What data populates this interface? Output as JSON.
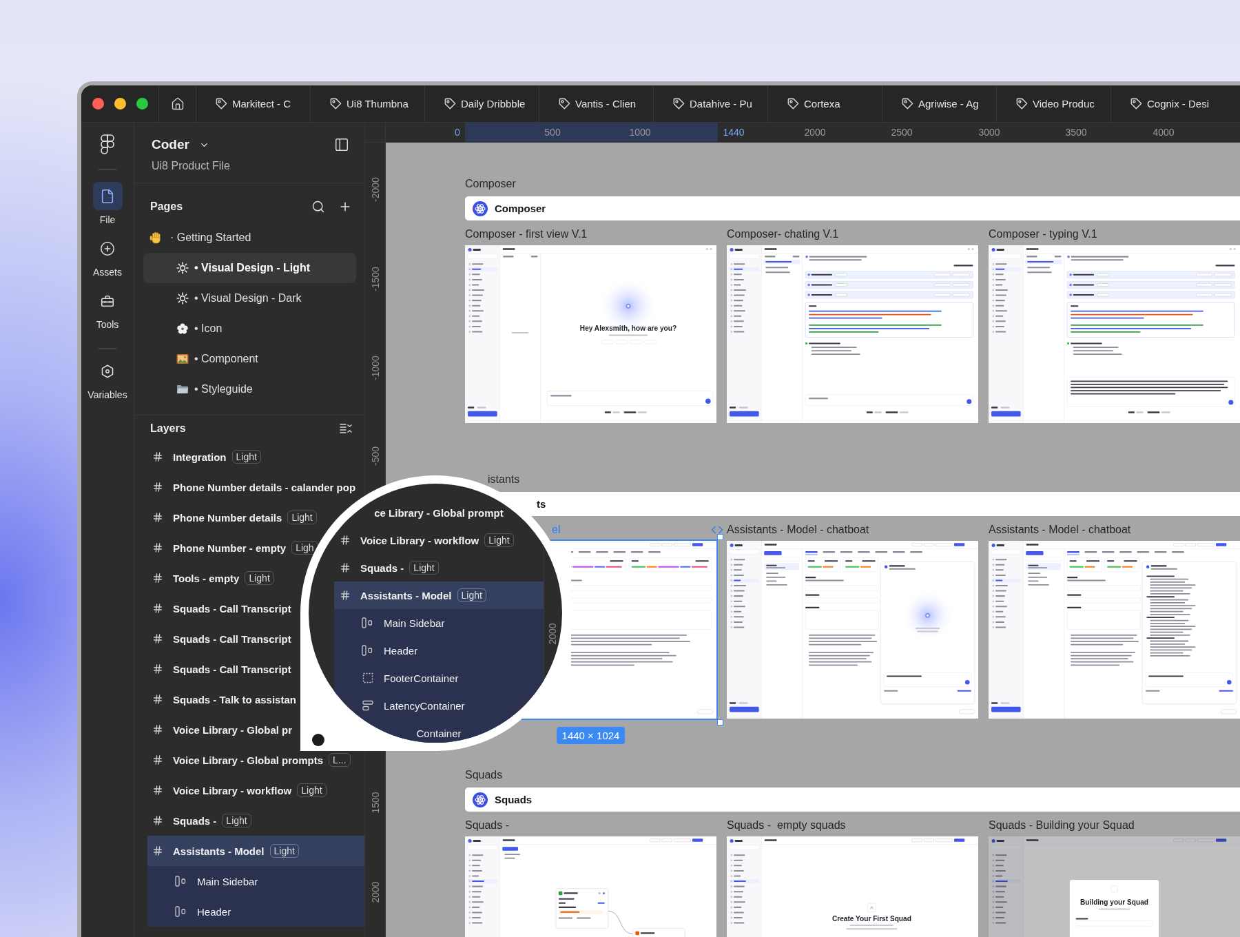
{
  "window": {
    "tabs": [
      {
        "label": "Markitect - C",
        "selected": false
      },
      {
        "label": "Ui8 Thumbna",
        "selected": false
      },
      {
        "label": "Daily Dribbble",
        "selected": false
      },
      {
        "label": "Vantis - Clien",
        "selected": false
      },
      {
        "label": "Datahive - Pu",
        "selected": false
      },
      {
        "label": "Cortexa",
        "selected": false
      },
      {
        "label": "Agriwise - Ag",
        "selected": false
      },
      {
        "label": "Video Produc",
        "selected": false
      },
      {
        "label": "Cognix - Desi",
        "selected": false
      }
    ]
  },
  "rail": {
    "items": [
      {
        "label": "File",
        "selected": true
      },
      {
        "label": "Assets",
        "selected": false
      },
      {
        "label": "Tools",
        "selected": false
      },
      {
        "label": "Variables",
        "selected": false
      }
    ]
  },
  "file": {
    "name": "Coder",
    "subtitle": "Ui8 Product File"
  },
  "pages": {
    "title": "Pages",
    "items": [
      {
        "kind": "heading",
        "label": "· Getting Started",
        "selected": false
      },
      {
        "kind": "page",
        "label": "• Visual Design - Light",
        "selected": true
      },
      {
        "kind": "page",
        "label": "• Visual Design - Dark",
        "selected": false
      },
      {
        "kind": "page",
        "label": "• Icon",
        "selected": false
      },
      {
        "kind": "page",
        "label": "• Component",
        "selected": false
      },
      {
        "kind": "page",
        "label": "• Styleguide",
        "selected": false
      }
    ]
  },
  "layers": {
    "title": "Layers",
    "items": [
      {
        "kind": "frame",
        "label": "Integration",
        "badge": "Light",
        "selected": false
      },
      {
        "kind": "frame",
        "label": "Phone Number details - calander pop",
        "selected": false
      },
      {
        "kind": "frame",
        "label": "Phone Number details",
        "badge": "Light",
        "selected": false
      },
      {
        "kind": "frame",
        "label": "Phone Number - empty",
        "badge": "Ligh",
        "selected": false
      },
      {
        "kind": "frame",
        "label": "Tools - empty",
        "badge": "Light",
        "selected": false
      },
      {
        "kind": "frame",
        "label": "Squads - Call Transcript",
        "selected": false
      },
      {
        "kind": "frame",
        "label": "Squads - Call Transcript",
        "selected": false
      },
      {
        "kind": "frame",
        "label": "Squads - Call Transcript",
        "selected": false
      },
      {
        "kind": "frame",
        "label": "Squads - Talk to assistan",
        "selected": false
      },
      {
        "kind": "frame",
        "label": "Voice Library - Global pr",
        "selected": false
      },
      {
        "kind": "frame",
        "label": "Voice Library - Global prompts",
        "badge": "L...",
        "selected": false
      },
      {
        "kind": "frame",
        "label": "Voice Library - workflow",
        "badge": "Light",
        "selected": false
      },
      {
        "kind": "frame",
        "label": "Squads -",
        "badge": "Light",
        "selected": false
      },
      {
        "kind": "frame",
        "label": "Assistants - Model",
        "badge": "Light",
        "selected": true,
        "children": [
          {
            "kind": "row-layout",
            "label": "Main Sidebar",
            "selected": false
          },
          {
            "kind": "row-layout",
            "label": "Header",
            "selected": false
          }
        ]
      }
    ]
  },
  "rulers": {
    "top": [
      {
        "label": "0",
        "highlighted": true
      },
      {
        "label": "500",
        "highlighted": false
      },
      {
        "label": "1000",
        "highlighted": false
      },
      {
        "label": "1440",
        "highlighted": true
      },
      {
        "label": "2000",
        "highlighted": false
      },
      {
        "label": "2500",
        "highlighted": false
      },
      {
        "label": "3000",
        "highlighted": false
      },
      {
        "label": "3500",
        "highlighted": false
      },
      {
        "label": "4000",
        "highlighted": false
      }
    ],
    "left": [
      {
        "label": "-2000"
      },
      {
        "label": "-1500"
      },
      {
        "label": "-1000"
      },
      {
        "label": "-500"
      },
      {
        "label": "1500"
      },
      {
        "label": "2000"
      }
    ]
  },
  "canvas": {
    "sections": [
      {
        "kind": "open",
        "label": "Composer",
        "bar": "Composer",
        "frames": [
          {
            "title": "Composer - first view V.1",
            "kind": "welcome",
            "heading": "Hey Alexsmith, how are you?",
            "selected": false,
            "dev_ready": false
          },
          {
            "title": "Composer- chating V.1",
            "kind": "chat",
            "selected": false,
            "dev_ready": false
          },
          {
            "title": "Composer - typing V.1",
            "kind": "typing",
            "selected": false,
            "dev_ready": false
          }
        ]
      },
      {
        "kind": "covered",
        "label": "istants",
        "bar": "ts",
        "frames": [
          {
            "title": "el",
            "kind": "settings",
            "selected": true,
            "dev_ready": false,
            "size": "1440 × 1024"
          },
          {
            "title": "Assistants - Model - chatboat",
            "kind": "assistant-chat",
            "selected": false,
            "dev_ready": true
          },
          {
            "title": "Assistants - Model - chatboat",
            "kind": "assistant-list",
            "selected": false,
            "dev_ready": false
          }
        ]
      },
      {
        "kind": "open",
        "label": "Squads",
        "bar": "Squads",
        "frames": [
          {
            "title": "Squads -",
            "kind": "flow",
            "selected": false,
            "dev_ready": false
          },
          {
            "title": "Squads -  empty squads",
            "kind": "empty",
            "heading": "Create Your First Squad",
            "selected": false,
            "dev_ready": false
          },
          {
            "title": "Squads - Building your Squad",
            "kind": "modal",
            "heading": "Building your Squad",
            "selected": false,
            "dev_ready": false
          }
        ]
      }
    ]
  },
  "magnifier": {
    "ruler_label": "2000",
    "items": [
      {
        "kind": "partial",
        "label": "ce Library - Global prompt",
        "selected": false
      },
      {
        "kind": "frame",
        "label": "Voice Library - workflow",
        "badge": "Light",
        "selected": false
      },
      {
        "kind": "frame",
        "label": "Squads -",
        "badge": "Light",
        "selected": false
      },
      {
        "kind": "frame",
        "label": "Assistants - Model",
        "badge": "Light",
        "selected": true,
        "children": [
          {
            "kind": "row-layout",
            "label": "Main Sidebar",
            "selected": false
          },
          {
            "kind": "row-layout",
            "label": "Header",
            "selected": false
          },
          {
            "kind": "group",
            "label": "FooterContainer",
            "selected": false
          },
          {
            "kind": "column-layout",
            "label": "LatencyContainer",
            "selected": false
          },
          {
            "kind": "partial",
            "label": "Container",
            "selected": false
          }
        ]
      }
    ]
  }
}
